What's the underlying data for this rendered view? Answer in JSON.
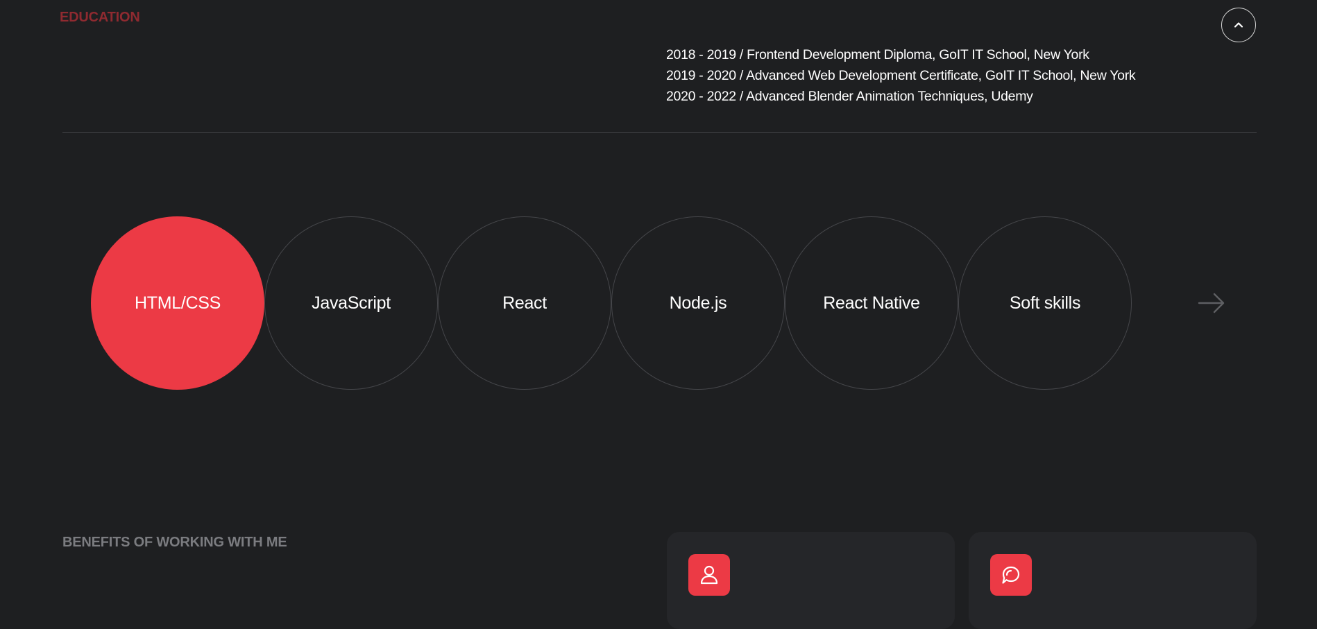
{
  "education": {
    "title": "EDUCATION",
    "items": [
      "2018 - 2019 / Frontend Development Diploma, GoIT IT School, New York",
      "2019 - 2020 / Advanced Web Development Certificate, GoIT IT School, New York",
      "2020 - 2022 / Advanced Blender Animation Techniques, Udemy"
    ]
  },
  "scroll_up": {
    "icon": "chevron-up-icon"
  },
  "skills": {
    "items": [
      "HTML/CSS",
      "JavaScript",
      "React",
      "Node.js",
      "React Native",
      "Soft skills"
    ],
    "active": "HTML/CSS",
    "next_icon": "arrow-right-icon"
  },
  "benefits": {
    "title": "BENEFITS OF WORKING WITH ME",
    "cards": [
      {
        "icon": "user-icon"
      },
      {
        "icon": "chat-bubble-icon"
      }
    ]
  },
  "colors": {
    "background": "#1e1f21",
    "accent": "#ec3a45",
    "education_title": "#8f2a30",
    "muted_title": "#7b7c80",
    "card_background": "#252629"
  }
}
